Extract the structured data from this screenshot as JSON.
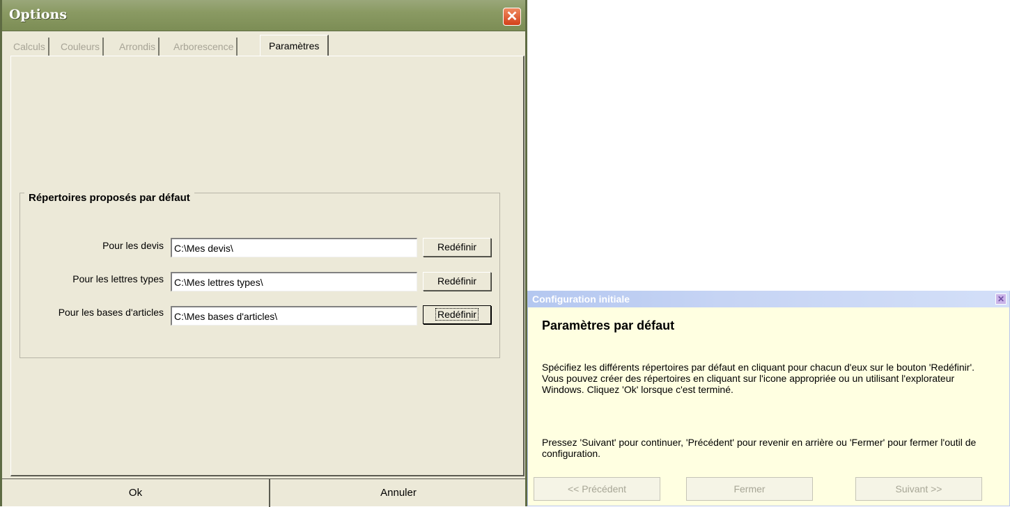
{
  "options": {
    "title": "Options",
    "tabs": [
      "Calculs",
      "Couleurs",
      "Arrondis",
      "Arborescence",
      "Paramètres"
    ],
    "active_tab": "Paramètres",
    "group_title": "Répertoires proposés par défaut",
    "rows": [
      {
        "label": "Pour les devis",
        "value": "C:\\Mes devis\\",
        "button": "Redéfinir"
      },
      {
        "label": "Pour les lettres types",
        "value": "C:\\Mes lettres types\\",
        "button": "Redéfinir"
      },
      {
        "label": "Pour les bases d'articles",
        "value": "C:\\Mes bases d'articles\\",
        "button": "Redéfinir"
      }
    ],
    "ok_label": "Ok",
    "cancel_label": "Annuler"
  },
  "config": {
    "title": "Configuration initiale",
    "heading": "Paramètres par défaut",
    "paragraph1": "Spécifiez les différents répertoires par défaut en cliquant pour chacun d'eux sur le bouton 'Redéfinir'. Vous pouvez créer des répertoires en cliquant sur l'icone appropriée ou un utilisant l'explorateur Windows. Cliquez 'Ok' lorsque c'est terminé.",
    "paragraph2": "Pressez 'Suivant' pour continuer, 'Précédent' pour revenir en arrière ou 'Fermer' pour fermer l'outil de configuration.",
    "prev_label": "<< Précédent",
    "close_label": "Fermer",
    "next_label": "Suivant >>"
  },
  "colors": {
    "options_titlebar": "#8a9a63",
    "dialog_face": "#ece9d8",
    "config_background": "#ffffe1",
    "config_titlebar": "#c6d4f4"
  },
  "icons": {
    "options_close": "close-icon",
    "config_close": "close-icon"
  }
}
